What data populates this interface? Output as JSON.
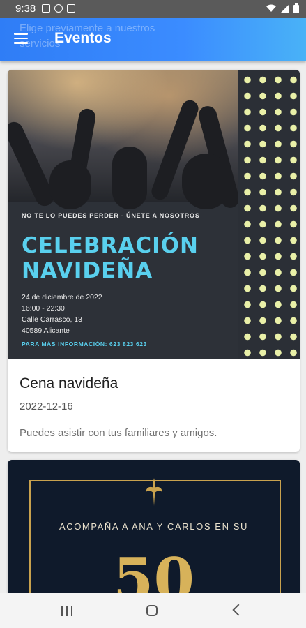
{
  "status_bar": {
    "time": "9:38",
    "left_icons": [
      "gallery-icon",
      "facebook-icon",
      "instagram-icon"
    ],
    "right_icons": [
      "wifi-icon",
      "signal-icon",
      "battery-icon"
    ]
  },
  "app_bar": {
    "menu_icon": "hamburger-menu-icon",
    "title": "Eventos",
    "scrolled_text_line1": "Elige previamente a nuestros",
    "scrolled_text_line2": "servicios"
  },
  "events": [
    {
      "poster": {
        "tagline": "NO TE LO PUEDES PERDER - ÚNETE A NOSOTROS",
        "title_line1": "CELEBRACIÓN",
        "title_line2": "NAVIDEÑA",
        "date": "24 de diciembre de 2022",
        "time": "16:00 - 22:30",
        "street": "Calle Carrasco, 13",
        "city": "40589 Alicante",
        "more_info": "PARA MÁS INFORMACIÓN: 623 823 623"
      },
      "title": "Cena navideña",
      "date": "2022-12-16",
      "description": "Puedes asistir con tus familiares y amigos."
    },
    {
      "poster": {
        "text": "ACOMPAÑA A ANA Y CARLOS EN SU",
        "number": "50"
      }
    }
  ],
  "colors": {
    "app_bar_start": "#2f7df6",
    "app_bar_end": "#49b2f7",
    "poster1_accent": "#59d0ee",
    "poster1_dots": "#e9f0a8",
    "poster2_gold": "#d7b25a",
    "poster2_bg": "#0f1a2b"
  },
  "nav_bar": {
    "icons": [
      "recents-icon",
      "home-icon",
      "back-icon"
    ]
  }
}
